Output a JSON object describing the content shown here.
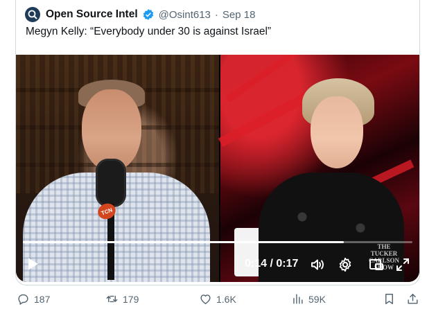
{
  "post": {
    "author_name": "Open Source Intel",
    "handle": "@Osint613",
    "separator": "·",
    "date": "Sep 18",
    "text": "Megyn Kelly: “Everybody under 30 is against Israel”"
  },
  "video": {
    "current_time": "0:14",
    "duration": "0:17",
    "time_display": "0:14 / 0:17",
    "progress_fraction": 0.824,
    "mic_flag_text": "TCN",
    "watermark_line1": "THE",
    "watermark_line2": "TUCKER",
    "watermark_line3": "CARLSON",
    "watermark_line4": "SHOW"
  },
  "actions": {
    "replies": "187",
    "reposts": "179",
    "likes": "1.6K",
    "views": "59K"
  },
  "icons": {
    "avatar": "osint-logo-icon",
    "verified": "verified-badge-icon",
    "play": "play-icon",
    "volume": "volume-icon",
    "settings": "gear-icon",
    "pip": "picture-in-picture-icon",
    "fullscreen": "fullscreen-icon",
    "reply": "reply-icon",
    "repost": "repost-icon",
    "like": "heart-icon",
    "views": "analytics-icon",
    "bookmark": "bookmark-icon",
    "share": "share-icon"
  },
  "colors": {
    "verified_blue": "#1d9bf0",
    "text_primary": "#0f1419",
    "text_secondary": "#536471",
    "border": "#cfd9de"
  }
}
